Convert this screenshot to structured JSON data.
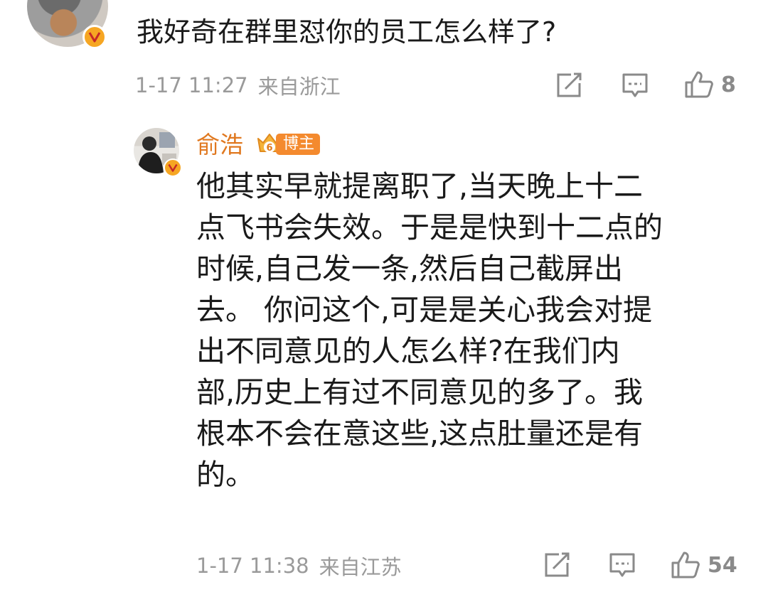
{
  "top_comment": {
    "text": "我好奇在群里怼你的员工怎么样了?",
    "time": "1-17 11:27",
    "location": "来自浙江",
    "likes": "8"
  },
  "reply": {
    "author": "俞浩",
    "level": "6",
    "author_tag": "博主",
    "lines": [
      "他其实早就提离职了,当天晚上十二",
      "点飞书会失效。于是是快到十二点的",
      "时候,自己发一条,然后自己截屏出",
      "去。 你问这个,可是是关心我会对提",
      "出不同意见的人怎么样?在我们内",
      "部,历史上有过不同意见的多了。我",
      "根本不会在意这些,这点肚量还是有",
      "的。"
    ],
    "time": "1-17 11:38",
    "location": "来自江苏",
    "likes": "54"
  },
  "icons": {
    "share": "share-icon",
    "comment": "comment-icon",
    "like": "thumbs-up-icon",
    "verified": "verified-v-icon",
    "level": "crown-level-icon"
  },
  "colors": {
    "author_name": "#e0781f",
    "author_tag_bg": "#f48a2e",
    "verified": "#f6a623",
    "meta": "#9a9a9a"
  }
}
